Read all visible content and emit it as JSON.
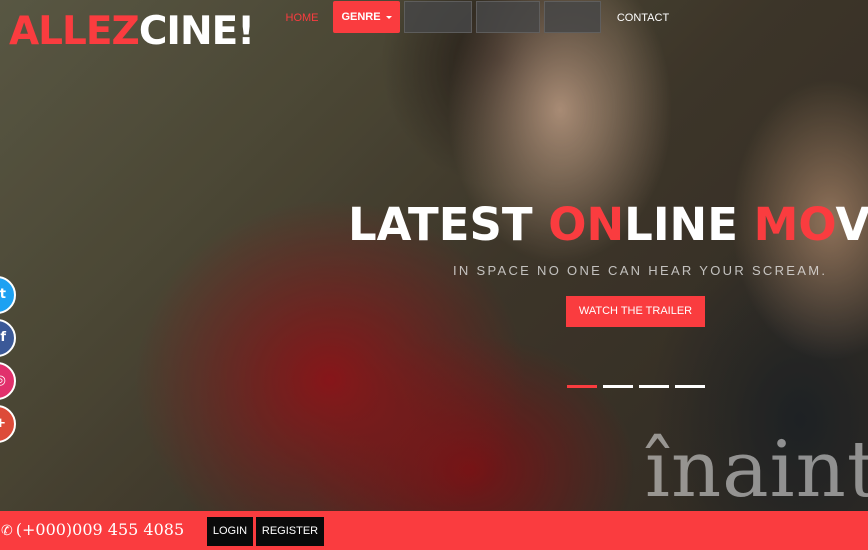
{
  "brand": {
    "logo_part1": "ALLEZ",
    "logo_part2": "CINE!",
    "accent_color": "#fa3c3f"
  },
  "nav": {
    "home": "HOME",
    "genre": "GENRE",
    "contact": "CONTACT"
  },
  "hero": {
    "title_1": "LATEST ",
    "title_2": "ON",
    "title_3": "LINE ",
    "title_4": "MO",
    "title_5": "VIE",
    "subtitle": "IN SPACE NO ONE CAN HEAR YOUR SCREAM.",
    "cta": "WATCH THE TRAILER",
    "watermark": "înaintu",
    "slides_count": 4,
    "active_slide": 1
  },
  "social": [
    {
      "name": "twitter",
      "icon": "twitter-icon",
      "color": "#1da1f2",
      "glyph": "t"
    },
    {
      "name": "facebook",
      "icon": "facebook-icon",
      "color": "#3b5998",
      "glyph": "f"
    },
    {
      "name": "instagram",
      "icon": "instagram-icon",
      "color": "#e1306c",
      "glyph": "◎"
    },
    {
      "name": "google-plus",
      "icon": "google-plus-icon",
      "color": "#dd4b39",
      "glyph": "+"
    }
  ],
  "bottom_bar": {
    "phone_icon": "phone-icon",
    "phone": "(+000)009 455 4085",
    "login": "LOGIN",
    "register": "REGISTER"
  }
}
